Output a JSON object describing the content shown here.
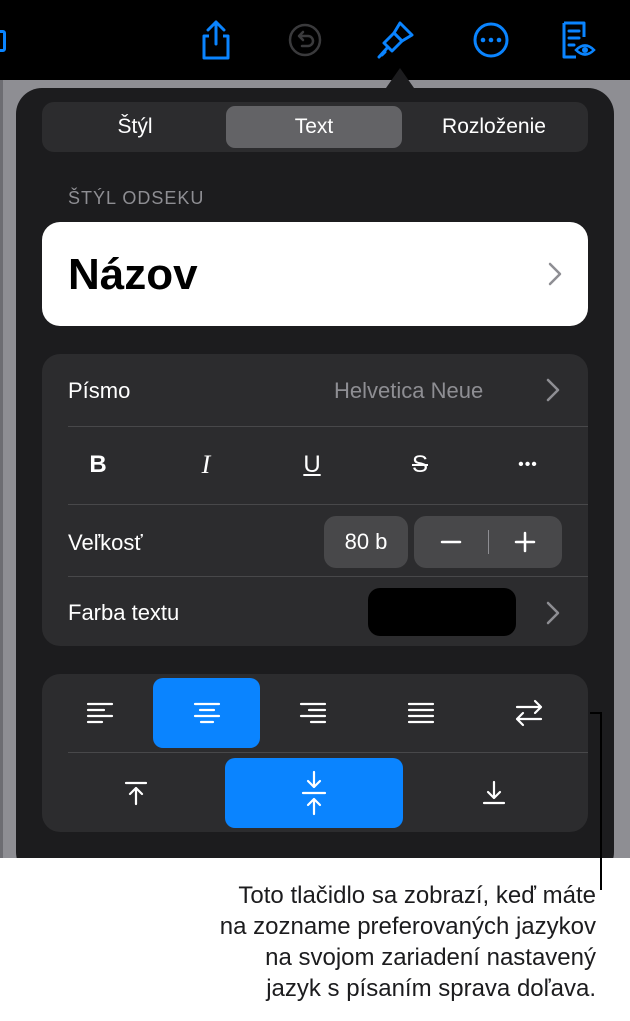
{
  "toolbar": {
    "icons": [
      "share-icon",
      "undo-icon",
      "paintbrush-icon",
      "more-icon",
      "reader-view-icon"
    ],
    "accent": "#0a84ff"
  },
  "tabs": [
    {
      "label": "Štýl",
      "active": false
    },
    {
      "label": "Text",
      "active": true
    },
    {
      "label": "Rozloženie",
      "active": false
    }
  ],
  "paragraph_style": {
    "section_label": "ŠTÝL ODSEKU",
    "name": "Názov"
  },
  "font": {
    "label": "Písmo",
    "value": "Helvetica Neue"
  },
  "format_buttons": {
    "bold": "B",
    "italic": "I",
    "underline": "U",
    "strikethrough": "S",
    "more": "•••"
  },
  "size": {
    "label": "Veľkosť",
    "value": "80 b"
  },
  "text_color": {
    "label": "Farba textu",
    "swatch": "#000000"
  },
  "alignment": {
    "horizontal": [
      "align-left",
      "align-center",
      "align-right",
      "align-justify",
      "rtl-toggle"
    ],
    "horizontal_selected": "align-center",
    "vertical": [
      "align-top",
      "align-middle",
      "align-bottom"
    ],
    "vertical_selected": "align-middle"
  },
  "callout": {
    "line1": "Toto tlačidlo sa zobrazí, keď máte",
    "line2": "na zozname preferovaných jazykov",
    "line3": "na svojom zariadení nastavený",
    "line4": "jazyk s písaním sprava doľava."
  }
}
